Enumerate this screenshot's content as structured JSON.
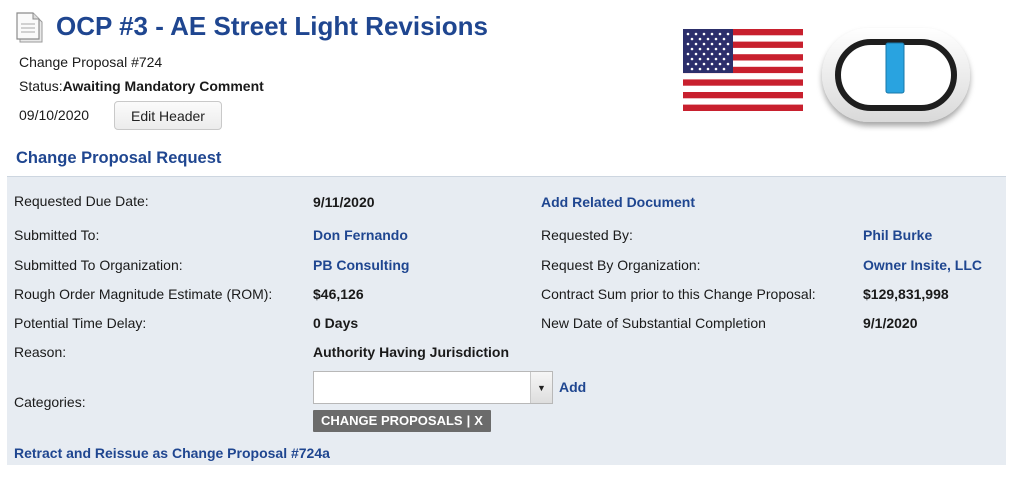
{
  "header": {
    "title": "OCP #3 - AE Street Light Revisions",
    "change_proposal": "Change Proposal #724",
    "status_label": "Status:",
    "status_value": "Awaiting Mandatory Comment",
    "date": "09/10/2020",
    "edit_button": "Edit Header"
  },
  "section_title": "Change Proposal Request",
  "details": {
    "requested_due_date_label": "Requested Due Date:",
    "requested_due_date_value": "9/11/2020",
    "add_related_document": "Add Related Document",
    "submitted_to_label": "Submitted To:",
    "submitted_to_value": "Don Fernando",
    "requested_by_label": "Requested By:",
    "requested_by_value": "Phil Burke",
    "submitted_org_label": "Submitted To Organization:",
    "submitted_org_value": "PB Consulting",
    "request_org_label": "Request By Organization:",
    "request_org_value": "Owner Insite, LLC",
    "rom_label": "Rough Order Magnitude Estimate (ROM):",
    "rom_value": "$46,126",
    "contract_sum_label": "Contract Sum prior to this Change Proposal:",
    "contract_sum_value": "$129,831,998",
    "time_delay_label": "Potential Time Delay:",
    "time_delay_value": "0 Days",
    "completion_label": "New Date of Substantial Completion",
    "completion_value": "9/1/2020",
    "reason_label": "Reason:",
    "reason_value": "Authority Having Jurisdiction",
    "categories_label": "Categories:",
    "categories_select_value": "",
    "add_link": "Add",
    "tag_label": "CHANGE PROPOSALS",
    "tag_separator": "|",
    "tag_remove": "X",
    "retract_link": "Retract and Reissue as Change Proposal #724a"
  },
  "icons": {
    "document": "document-icon",
    "flag": "us-flag-icon",
    "logo": "pill-logo-icon",
    "dropdown": "chevron-down-icon"
  },
  "colors": {
    "accent_blue": "#1f4690",
    "panel_bg": "#e7ecf2",
    "tag_bg": "#6b6b6b",
    "logo_blue": "#29a3e0"
  }
}
